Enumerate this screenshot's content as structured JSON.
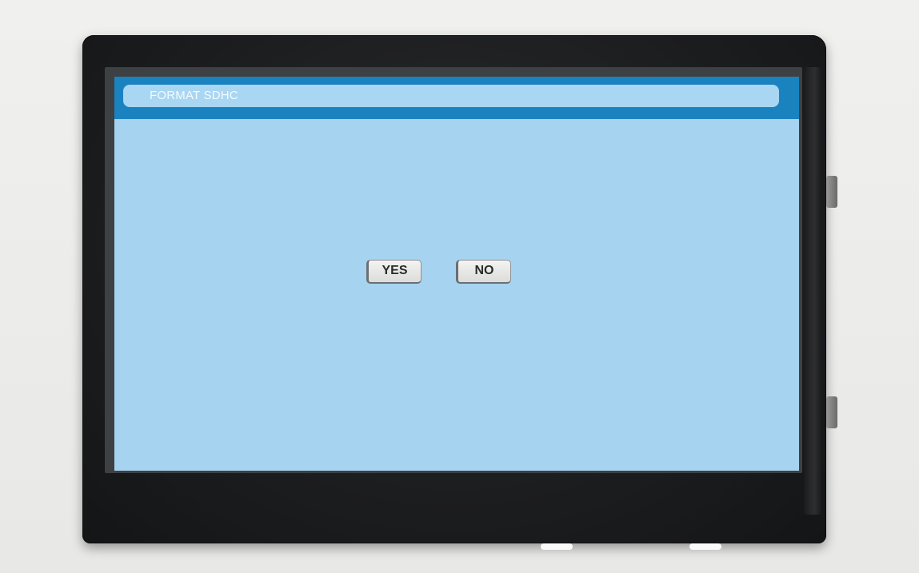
{
  "screen": {
    "title": "FORMAT SDHC",
    "background_color": "#a6d3ef",
    "title_bar_color": "#1b82c0"
  },
  "dialog": {
    "yes_label": "YES",
    "no_label": "NO"
  }
}
